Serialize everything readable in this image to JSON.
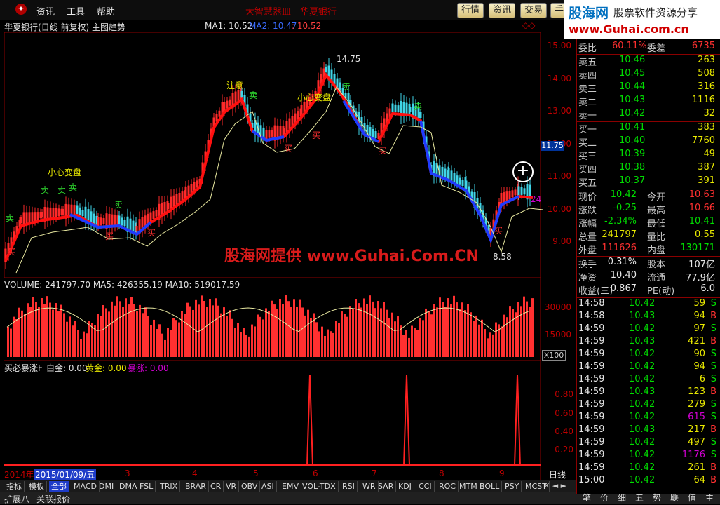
{
  "menu": {
    "items": [
      "资讯",
      "工具",
      "帮助"
    ],
    "scroll_title": "大智慧器皿　华夏银行",
    "nav_buttons": [
      "行情",
      "资讯",
      "交易",
      "手"
    ]
  },
  "logo": {
    "main": "股海网",
    "sub": "股票软件资源分享",
    "url": "www.Guhai.com.cn"
  },
  "chart": {
    "title": "华夏银行(日线 前复权) 主图趋势",
    "ma1_label": "MA1: 10.52",
    "ma2_label": "MA2: 10.47",
    "ma3_label": ": 10.52",
    "y_ticks": [
      "15.00",
      "14.00",
      "13.00",
      "12.00",
      "11.00",
      "10.00",
      "9.00"
    ],
    "current_price_tag": "11.75",
    "annotations": {
      "high": "14.75",
      "low": "8.58",
      "small_watch": "小心变盘",
      "notice": "注意",
      "right_edge": "24"
    },
    "buy_label": "买",
    "sell_label": "卖"
  },
  "volume": {
    "label": "VOLUME: 241797.70  MA5: 426355.19  MA10: 519017.59",
    "y_ticks": [
      "30000",
      "15000"
    ],
    "unit": "X100"
  },
  "indicator": {
    "name": "买必暴涨F",
    "white": "白金: 0.00",
    "gold": "黄金: 0.00",
    "rise": "暴涨: 0.00",
    "y_ticks": [
      "0.80",
      "0.60",
      "0.40",
      "0.20"
    ]
  },
  "dates": {
    "year": "2014年",
    "current": "2015/01/09/五",
    "months": [
      "3",
      "4",
      "5",
      "6",
      "7",
      "8",
      "9"
    ],
    "period": "日线"
  },
  "tabs": [
    "指标",
    "模板",
    "全部",
    "MACD",
    "DMI",
    "DMA",
    "FSL",
    "TRIX",
    "BRAR",
    "CR",
    "VR",
    "OBV",
    "ASI",
    "EMV",
    "VOL-TDX",
    "RSI",
    "WR",
    "SAR",
    "KDJ",
    "CCI",
    "ROC",
    "MTM",
    "BOLL",
    "PSY",
    "MCST"
  ],
  "status": {
    "left": "扩展八",
    "right": "关联报价"
  },
  "quote": {
    "weibi": {
      "label": "委比",
      "value": "60.11%",
      "label2": "委差",
      "value2": "6735"
    },
    "asks": [
      {
        "label": "卖五",
        "price": "10.46",
        "vol": "263"
      },
      {
        "label": "卖四",
        "price": "10.45",
        "vol": "508"
      },
      {
        "label": "卖三",
        "price": "10.44",
        "vol": "316"
      },
      {
        "label": "卖二",
        "price": "10.43",
        "vol": "1116"
      },
      {
        "label": "卖一",
        "price": "10.42",
        "vol": "32"
      }
    ],
    "bids": [
      {
        "label": "买一",
        "price": "10.41",
        "vol": "383"
      },
      {
        "label": "买二",
        "price": "10.40",
        "vol": "7760"
      },
      {
        "label": "买三",
        "price": "10.39",
        "vol": "49"
      },
      {
        "label": "买四",
        "price": "10.38",
        "vol": "387"
      },
      {
        "label": "买五",
        "price": "10.37",
        "vol": "391"
      }
    ],
    "stats": [
      {
        "l1": "现价",
        "v1": "10.42",
        "l2": "今开",
        "v2": "10.63"
      },
      {
        "l1": "涨跌",
        "v1": "-0.25",
        "l2": "最高",
        "v2": "10.66"
      },
      {
        "l1": "涨幅",
        "v1": "-2.34%",
        "l2": "最低",
        "v2": "10.41"
      },
      {
        "l1": "总量",
        "v1": "241797",
        "l2": "量比",
        "v2": "0.55"
      },
      {
        "l1": "外盘",
        "v1": "111626",
        "l2": "内盘",
        "v2": "130171"
      }
    ],
    "stats2": [
      {
        "l1": "换手",
        "v1": "0.31%",
        "l2": "股本",
        "v2": "107亿"
      },
      {
        "l1": "净资",
        "v1": "10.40",
        "l2": "流通",
        "v2": "77.9亿"
      },
      {
        "l1": "收益(三)",
        "v1": "0.867",
        "l2": "PE(动)",
        "v2": "6.0"
      }
    ],
    "trades": [
      {
        "t": "14:58",
        "p": "10.42",
        "v": "59",
        "s": "S"
      },
      {
        "t": "14:58",
        "p": "10.43",
        "v": "94",
        "s": "B"
      },
      {
        "t": "14:59",
        "p": "10.42",
        "v": "97",
        "s": "S"
      },
      {
        "t": "14:59",
        "p": "10.43",
        "v": "421",
        "s": "B"
      },
      {
        "t": "14:59",
        "p": "10.42",
        "v": "90",
        "s": "S"
      },
      {
        "t": "14:59",
        "p": "10.42",
        "v": "94",
        "s": "S"
      },
      {
        "t": "14:59",
        "p": "10.42",
        "v": "6",
        "s": "S"
      },
      {
        "t": "14:59",
        "p": "10.43",
        "v": "123",
        "s": "B"
      },
      {
        "t": "14:59",
        "p": "10.42",
        "v": "279",
        "s": "S"
      },
      {
        "t": "14:59",
        "p": "10.42",
        "v": "615",
        "s": "S"
      },
      {
        "t": "14:59",
        "p": "10.43",
        "v": "217",
        "s": "B"
      },
      {
        "t": "14:59",
        "p": "10.42",
        "v": "497",
        "s": "S"
      },
      {
        "t": "14:59",
        "p": "10.42",
        "v": "1176",
        "s": "S"
      },
      {
        "t": "14:59",
        "p": "10.42",
        "v": "261",
        "s": "B"
      },
      {
        "t": "15:00",
        "p": "10.42",
        "v": "64",
        "s": "B"
      }
    ],
    "bottom_tabs": [
      "笔",
      "价",
      "细",
      "五",
      "势",
      "联",
      "值",
      "主"
    ]
  },
  "watermark": "股海网提供 www.Guhai.Com.CN"
}
